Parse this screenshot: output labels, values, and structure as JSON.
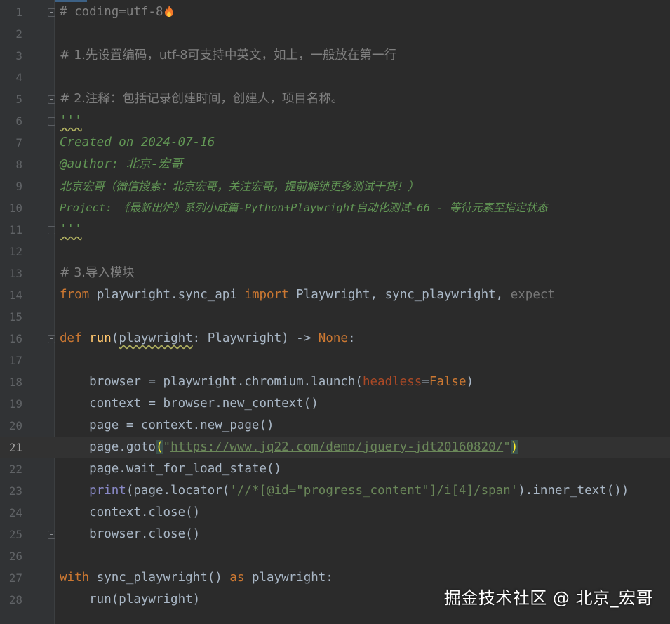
{
  "editor": {
    "current_line": 21,
    "line_numbers": [
      "1",
      "2",
      "3",
      "4",
      "5",
      "6",
      "7",
      "8",
      "9",
      "10",
      "11",
      "12",
      "13",
      "14",
      "15",
      "16",
      "17",
      "18",
      "19",
      "20",
      "21",
      "22",
      "23",
      "24",
      "25",
      "26",
      "27",
      "28"
    ],
    "lines": {
      "l1_hash": "# coding=utf-8",
      "l3": "# 1.先设置编码，utf-8可支持中英文，如上，一般放在第一行",
      "l5": "# 2.注释：包括记录创建时间，创建人，项目名称。",
      "l6": "'''",
      "l7": "Created on 2024-07-16",
      "l8": "@author: 北京-宏哥",
      "l9": "北京宏哥（微信搜索：北京宏哥，关注宏哥，提前解锁更多测试干货！）",
      "l10": "Project: 《最新出炉》系列小成篇-Python+Playwright自动化测试-66 - 等待元素至指定状态",
      "l11": "'''",
      "l13": "# 3.导入模块",
      "l14_from": "from",
      "l14_mod": " playwright.sync_api ",
      "l14_import": "import",
      "l14_names": " Playwright, sync_playwright, ",
      "l14_expect": "expect",
      "l16_def": "def",
      "l16_fn": "run",
      "l16_open": "(",
      "l16_param": "playwright",
      "l16_rest": ": Playwright) -> ",
      "l16_none": "None",
      "l16_colon": ":",
      "l18_a": "    browser = playwright.chromium.launch(",
      "l18_kw": "headless",
      "l18_eq": "=",
      "l18_false": "False",
      "l18_close": ")",
      "l19": "    context = browser.new_context()",
      "l20": "    page = context.new_page()",
      "l21_a": "    page.goto",
      "l21_open": "(",
      "l21_q1": "\"",
      "l21_url": "https://www.jq22.com/demo/jquery-jdt20160820/",
      "l21_q2": "\"",
      "l21_close": ")",
      "l22": "    page.wait_for_load_state()",
      "l23_indent": "    ",
      "l23_print": "print",
      "l23_a": "(page.locator(",
      "l23_str": "'//*[@id=\"progress_content\"]/i[4]/span'",
      "l23_b": ").inner_text())",
      "l24": "    context.close()",
      "l25": "    browser.close()",
      "l27_with": "with",
      "l27_a": " sync_playwright() ",
      "l27_as": "as",
      "l27_b": " playwright:",
      "l28": "    run(playwright)"
    },
    "icons": {
      "flame": "fire-emoji-icon",
      "fold": "fold-marker-icon"
    }
  },
  "watermark": "掘金技术社区 @ 北京_宏哥",
  "colors": {
    "background": "#2b2b2b",
    "gutter": "#313335",
    "comment": "#808080",
    "docstring": "#629755",
    "keyword": "#cc7832",
    "function": "#ffc66d",
    "builtin": "#8888c6",
    "param": "#aa4926",
    "string": "#6a8759",
    "text": "#a9b7c6"
  }
}
